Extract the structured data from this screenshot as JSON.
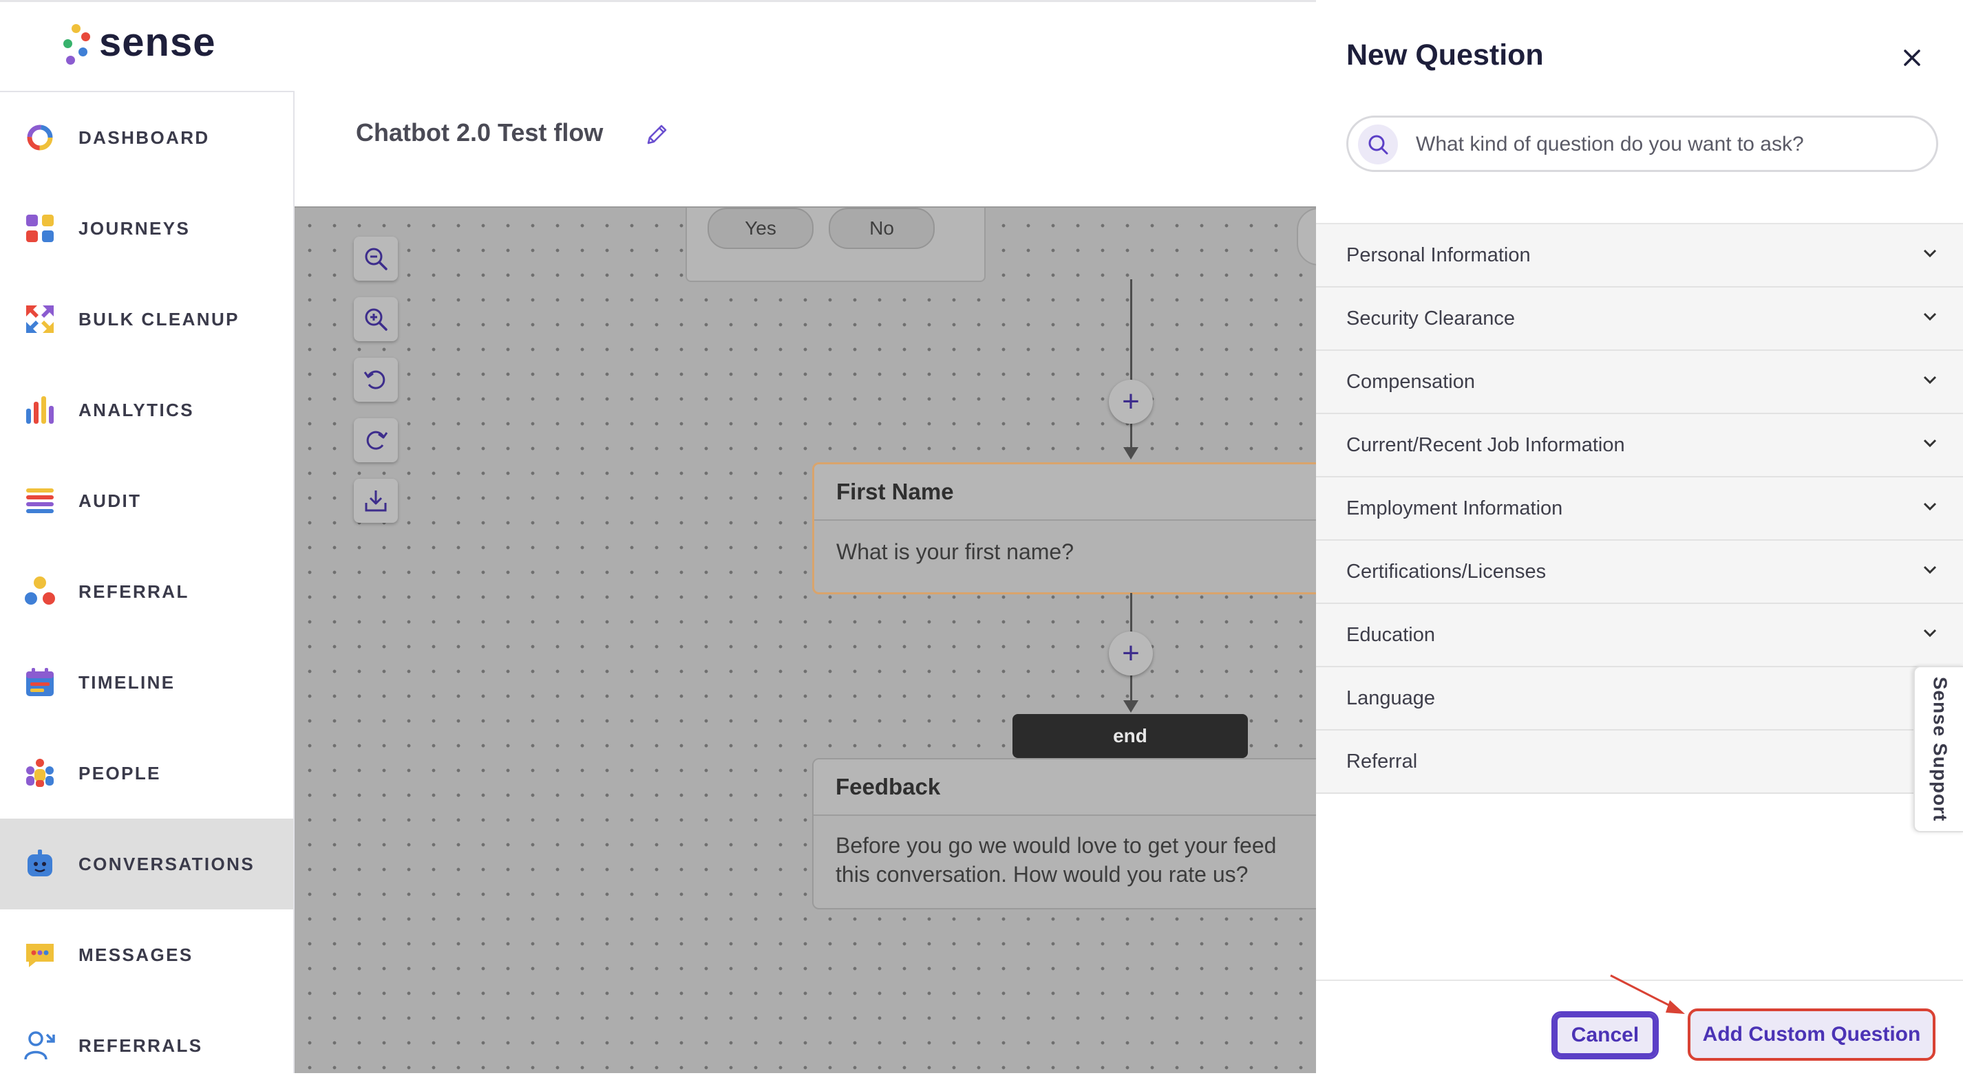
{
  "brand": {
    "name": "sense",
    "dot_colors": [
      "#f0c03a",
      "#e8483b",
      "#37b26c",
      "#3f7fd6",
      "#8b5cd0"
    ]
  },
  "sidebar": {
    "items": [
      {
        "label": "DASHBOARD",
        "icon": "dashboard-ring-icon"
      },
      {
        "label": "JOURNEYS",
        "icon": "journeys-grid-icon"
      },
      {
        "label": "BULK CLEANUP",
        "icon": "bulk-cleanup-arrows-icon"
      },
      {
        "label": "ANALYTICS",
        "icon": "analytics-bars-icon"
      },
      {
        "label": "AUDIT",
        "icon": "audit-list-icon"
      },
      {
        "label": "REFERRAL",
        "icon": "referral-people-icon"
      },
      {
        "label": "TIMELINE",
        "icon": "timeline-calendar-icon"
      },
      {
        "label": "PEOPLE",
        "icon": "people-group-icon"
      },
      {
        "label": "CONVERSATIONS",
        "icon": "conversations-bot-icon",
        "active": true
      },
      {
        "label": "MESSAGES",
        "icon": "messages-bubble-icon"
      },
      {
        "label": "REFERRALS",
        "icon": "referrals-user-icon"
      }
    ]
  },
  "header": {
    "flow_title": "Chatbot 2.0 Test flow"
  },
  "canvas": {
    "branch_options": [
      "Yes",
      "No"
    ],
    "nodes": [
      {
        "title": "First Name",
        "body": "What is your first name?"
      },
      {
        "title": "Feedback",
        "body_line1": "Before you go we would love to get your feed",
        "body_line2": "this conversation. How would you rate us?"
      }
    ],
    "end_label": "end",
    "tools": [
      "zoom-out-icon",
      "zoom-in-icon",
      "undo-icon",
      "redo-icon",
      "download-icon"
    ]
  },
  "panel": {
    "title": "New Question",
    "search_placeholder": "What kind of question do you want to ask?",
    "categories": [
      {
        "label": "Personal Information",
        "expandable": true
      },
      {
        "label": "Security Clearance",
        "expandable": true
      },
      {
        "label": "Compensation",
        "expandable": true
      },
      {
        "label": "Current/Recent Job Information",
        "expandable": true
      },
      {
        "label": "Employment Information",
        "expandable": true
      },
      {
        "label": "Certifications/Licenses",
        "expandable": true
      },
      {
        "label": "Education",
        "expandable": true
      },
      {
        "label": "Language",
        "expandable": false
      },
      {
        "label": "Referral",
        "expandable": false
      }
    ],
    "cancel_label": "Cancel",
    "add_label": "Add Custom Question",
    "support_label": "Sense Support"
  },
  "colors": {
    "accent": "#4b33b5",
    "highlight": "#d94234",
    "active_nav": "#dedede"
  }
}
